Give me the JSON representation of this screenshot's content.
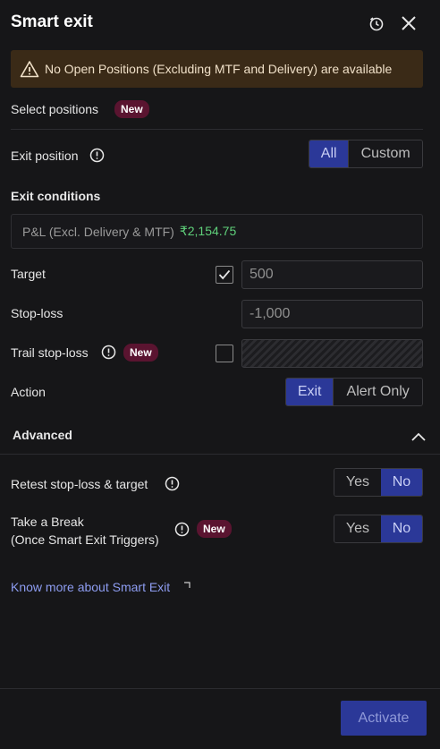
{
  "header": {
    "title": "Smart exit",
    "history_icon": "history-icon",
    "close_icon": "close-icon"
  },
  "warning": {
    "icon": "warning-triangle-icon",
    "text": "No Open Positions (Excluding MTF and Delivery) are available"
  },
  "select_positions": {
    "label": "Select positions",
    "badge": "New"
  },
  "exit_position": {
    "label": "Exit position",
    "options": [
      "All",
      "Custom"
    ],
    "selected": "All"
  },
  "exit_conditions": {
    "label": "Exit conditions",
    "pnl_label": "P&L (Excl. Delivery & MTF)",
    "pnl_value": "₹2,154.75",
    "pnl_color": "#5fd07a"
  },
  "target": {
    "label": "Target",
    "checked": true,
    "value": "500"
  },
  "stop_loss": {
    "label": "Stop-loss",
    "value": "-1,000"
  },
  "trail_stop_loss": {
    "label": "Trail stop-loss",
    "badge": "New",
    "checked": false
  },
  "action": {
    "label": "Action",
    "options": [
      "Exit",
      "Alert Only"
    ],
    "selected": "Exit"
  },
  "advanced": {
    "label": "Advanced",
    "expanded": true,
    "retest": {
      "label": "Retest stop-loss & target",
      "options": [
        "Yes",
        "No"
      ],
      "selected": "No"
    },
    "take_break": {
      "label_line1": "Take a Break",
      "label_line2": "(Once Smart Exit Triggers)",
      "badge": "New",
      "options": [
        "Yes",
        "No"
      ],
      "selected": "No"
    }
  },
  "know_more": {
    "text": "Know more about Smart Exit"
  },
  "footer": {
    "activate_label": "Activate"
  },
  "colors": {
    "accent": "#2b3898",
    "badge": "#5a1430",
    "warning_bg": "#3a2a17",
    "link": "#8d9cf0"
  }
}
